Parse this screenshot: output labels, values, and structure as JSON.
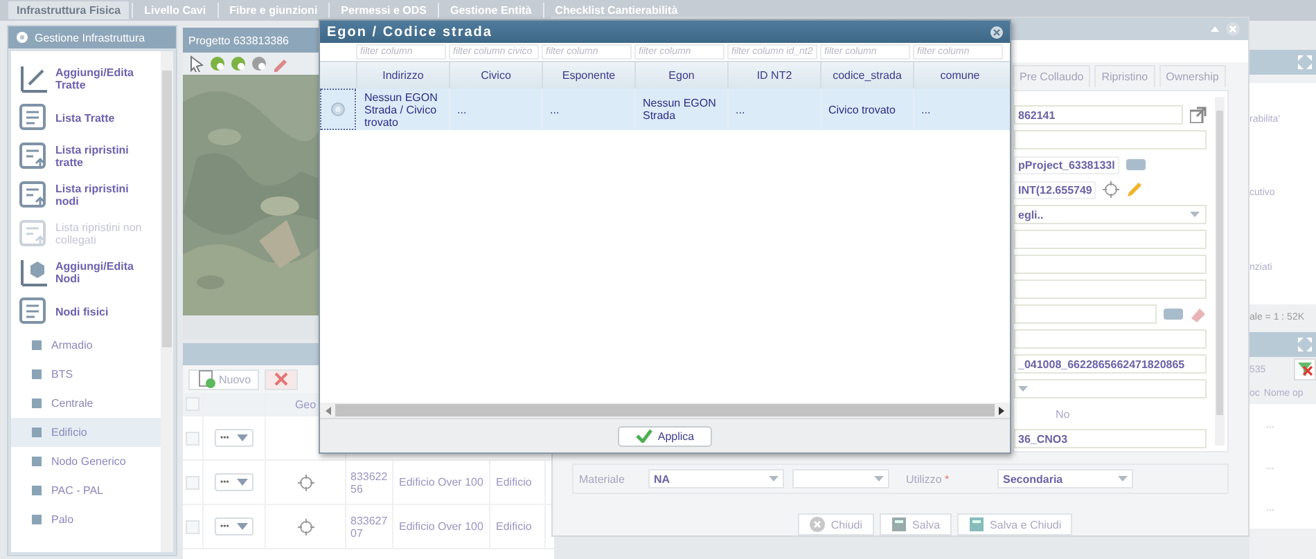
{
  "menu": [
    {
      "label": "Infrastruttura Fisica",
      "selected": true
    },
    {
      "label": "Livello Cavi",
      "selected": false
    },
    {
      "label": "Fibre e giunzioni",
      "selected": false
    },
    {
      "label": "Permessi e ODS",
      "selected": false
    },
    {
      "label": "Gestione Entità",
      "selected": false
    },
    {
      "label": "Checklist Cantierabilità",
      "selected": false
    }
  ],
  "sidebar": {
    "title": "Gestione Infrastruttura",
    "tools": [
      {
        "label": "Aggiungi/Edita Tratte",
        "kind": "edit-line",
        "disabled": false
      },
      {
        "label": "Lista Tratte",
        "kind": "list",
        "disabled": false
      },
      {
        "label": "Lista ripristini tratte",
        "kind": "list-up",
        "disabled": false
      },
      {
        "label": "Lista ripristini nodi",
        "kind": "list-up",
        "disabled": false
      },
      {
        "label": "Lista ripristini non collegati",
        "kind": "list-up",
        "disabled": true
      },
      {
        "label": "Aggiungi/Edita Nodi",
        "kind": "edit-node",
        "disabled": false
      },
      {
        "label": "Nodi fisici",
        "kind": "list",
        "disabled": false
      }
    ],
    "node_types": [
      {
        "label": "Armadio",
        "selected": false
      },
      {
        "label": "BTS",
        "selected": false
      },
      {
        "label": "Centrale",
        "selected": false
      },
      {
        "label": "Edificio",
        "selected": true
      },
      {
        "label": "Nodo Generico",
        "selected": false
      },
      {
        "label": "PAC - PAL",
        "selected": false
      },
      {
        "label": "Palo",
        "selected": false
      }
    ]
  },
  "map": {
    "tab": "Progetto 633813386"
  },
  "grid": {
    "new_button": "Nuovo",
    "column": "Geo",
    "all_checked": false,
    "rows": [
      {
        "checked": false,
        "menu": "•••"
      },
      {
        "checked": false,
        "menu": "•••",
        "id": "83362256",
        "name": "Edificio Over 100",
        "type": "Edificio"
      },
      {
        "checked": false,
        "menu": "•••",
        "id": "83362707",
        "name": "Edificio Over 100",
        "type": "Edificio"
      }
    ]
  },
  "editor": {
    "tabs": [
      {
        "label": "Pre Collaudo",
        "selected": false
      },
      {
        "label": "Ripristino",
        "selected": false
      },
      {
        "label": "Ownership",
        "selected": false
      }
    ],
    "fields": [
      {
        "kind": "text-popout",
        "value": "862141"
      },
      {
        "kind": "text"
      },
      {
        "kind": "text-button",
        "value": "pProject_6338133l"
      },
      {
        "kind": "text-locate",
        "value": "INT(12.655749"
      },
      {
        "kind": "select",
        "value": "egli.."
      },
      {
        "kind": "text"
      },
      {
        "kind": "text"
      },
      {
        "kind": "text"
      },
      {
        "kind": "text-erase"
      },
      {
        "kind": "text"
      },
      {
        "kind": "text",
        "value": "_041008_6622865662471820865"
      },
      {
        "kind": "select"
      },
      {
        "kind": "radio",
        "value": "No"
      },
      {
        "kind": "text",
        "value": "36_CNO3"
      }
    ],
    "materiale": {
      "label": "Materiale",
      "value": "NA"
    },
    "utilizzo": {
      "label": "Utilizzo",
      "required_mark": "*",
      "value": "Secondaria"
    },
    "buttons": [
      {
        "label": "Chiudi",
        "kind": "close"
      },
      {
        "label": "Salva",
        "kind": "save"
      },
      {
        "label": "Salva e Chiudi",
        "kind": "save-close"
      }
    ]
  },
  "side_panel": {
    "lines": [
      "rabilita'",
      "cutivo",
      "nziati"
    ],
    "scale": "ale = 1 : 52K",
    "count": "535",
    "columns": [
      "oc",
      "Nome op"
    ],
    "cells": [
      "...",
      "...",
      "..."
    ]
  },
  "dialog": {
    "title": "Egon / Codice strada",
    "filters": [
      {
        "placeholder": "filter column"
      },
      {
        "placeholder": "filter column civico"
      },
      {
        "placeholder": "filter column"
      },
      {
        "placeholder": "filter column"
      },
      {
        "placeholder": "filter column id_nt2"
      },
      {
        "placeholder": "filter column"
      },
      {
        "placeholder": "filter column"
      }
    ],
    "columns": [
      "Indirizzo",
      "Civico",
      "Esponente",
      "Egon",
      "ID NT2",
      "codice_strada",
      "comune"
    ],
    "rows": [
      {
        "selected": true,
        "cells": [
          "Nessun EGON Strada / Civico trovato",
          "...",
          "...",
          "Nessun EGON Strada",
          "...",
          "Civico trovato",
          "..."
        ]
      }
    ],
    "apply_button": "Applica"
  }
}
